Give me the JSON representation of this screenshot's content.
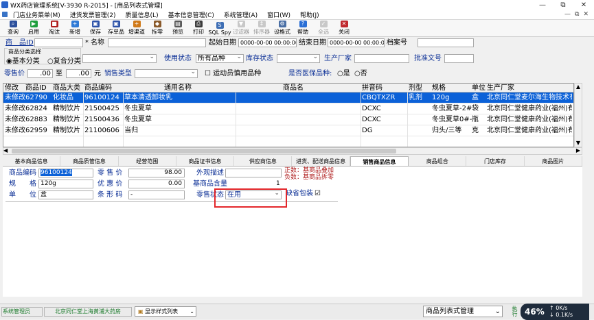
{
  "window": {
    "title": "WX药店管理系统[V-3930 R-2015] - [商品列表式管理]",
    "controls": [
      "—",
      "⧉",
      "✕"
    ]
  },
  "menu": [
    "门店业务菜单(M)",
    "进货发票管理(2)",
    "质量信息(L)",
    "基本信息管理(C)",
    "系统管理(A)",
    "窗口(W)",
    "帮助(J)"
  ],
  "menu_right": [
    "—",
    "⧉",
    "✕"
  ],
  "toolbar": [
    {
      "label": "查询",
      "icon": "binoculars-icon",
      "color": "#2b4f9c",
      "glyph": "⌕",
      "disabled": false
    },
    {
      "label": "启用",
      "icon": "play-icon",
      "color": "#1e9e3c",
      "glyph": "▶",
      "disabled": false
    },
    {
      "label": "淘汰",
      "icon": "stop-icon",
      "color": "#b01e1e",
      "glyph": "■",
      "disabled": false
    },
    {
      "label": "新增",
      "icon": "new-doc-icon",
      "color": "#2f7ad6",
      "glyph": "+",
      "disabled": false
    },
    {
      "label": "保存",
      "icon": "save-icon",
      "color": "#2d52a8",
      "glyph": "▣",
      "disabled": false
    },
    {
      "label": "存单品",
      "icon": "save-item-icon",
      "color": "#2d52a8",
      "glyph": "▣",
      "disabled": false
    },
    {
      "label": "增渠道",
      "icon": "add-channel-icon",
      "color": "#d07a1a",
      "glyph": "+",
      "disabled": false
    },
    {
      "label": "拆零",
      "icon": "split-icon",
      "color": "#8a5a2b",
      "glyph": "◆",
      "disabled": false
    },
    {
      "label": "预览",
      "icon": "preview-icon",
      "color": "#5a5a5a",
      "glyph": "▤",
      "disabled": false
    },
    {
      "label": "打印",
      "icon": "print-icon",
      "color": "#3b3b3b",
      "glyph": "⎙",
      "disabled": false
    },
    {
      "label": "SQL Spy",
      "icon": "sql-spy-icon",
      "color": "#3f6fb5",
      "glyph": "S",
      "disabled": false
    },
    {
      "label": "过滤器",
      "icon": "filter-icon",
      "color": "#888",
      "glyph": "▼",
      "disabled": true
    },
    {
      "label": "排序器",
      "icon": "sort-icon",
      "color": "#888",
      "glyph": "↕",
      "disabled": true
    },
    {
      "label": "设格式",
      "icon": "format-icon",
      "color": "#4a6fa5",
      "glyph": "⚙",
      "disabled": false
    },
    {
      "label": "帮助",
      "icon": "help-icon",
      "color": "#2a6fd6",
      "glyph": "?",
      "disabled": false
    },
    {
      "label": "全选",
      "icon": "select-all-icon",
      "color": "#888",
      "glyph": "✓",
      "disabled": true
    },
    {
      "label": "关闭",
      "icon": "close-icon",
      "color": "#c0282d",
      "glyph": "✕",
      "disabled": false
    }
  ],
  "filters": {
    "product_id_label": "商　品ID",
    "name_label": "名称",
    "start_date_label": "起始日期",
    "start_date_value": "0000-00-00 00:00:00",
    "end_date_label": "结束日期",
    "end_date_value": "0000-00-00 00:00:00",
    "archive_label": "档案号",
    "category_group_label": "商品分类选择",
    "basic_category": "基本分类",
    "compound_category": "复合分类",
    "usage_status_label": "使用状态",
    "usage_status_value": "所有品种",
    "stock_status_label": "库存状态",
    "manufacturer_label": "生产厂家",
    "retail_price_label": "零售价",
    "price_from": ".00",
    "to_label": "至",
    "price_to": ".00",
    "yuan_label": "元",
    "sales_type_label": "销售类型",
    "athlete_label": "运动员慎用品种",
    "approval_label": "批准文号",
    "medical_label": "是否医保品种:",
    "yes_label": "是",
    "no_label": "否"
  },
  "grid": {
    "headers": [
      "修改",
      "商品ID",
      "商品大类",
      "商品编码",
      "通用名称",
      "商品名",
      "拼音码",
      "剂型",
      "规格",
      "单位",
      "生产厂家"
    ],
    "rows": [
      [
        "未修改",
        "62790",
        "化妆品",
        "96100124",
        "草本清透卸妆乳",
        "",
        "CBQTXZR",
        "乳剂",
        "120g",
        "盒",
        "北京同仁堂麦尔海生物技术有"
      ],
      [
        "未修改",
        "62824",
        "精制饮片",
        "21500425",
        "冬虫夏草",
        "",
        "DCXC",
        "",
        "冬虫夏草-2#",
        "袋",
        "北京同仁堂健康药业(福州)有"
      ],
      [
        "未修改",
        "62883",
        "精制饮片",
        "21500436",
        "冬虫夏草",
        "",
        "DCXC",
        "",
        "冬虫夏草0#-",
        "瓶",
        "北京同仁堂健康药业(福州)有"
      ],
      [
        "未修改",
        "62959",
        "精制饮片",
        "21100606",
        "当归",
        "",
        "DG",
        "",
        "归头/三等",
        "克",
        "北京同仁堂健康药业(福州)有"
      ]
    ]
  },
  "tabs": [
    "基本商品信息",
    "商品质管信息",
    "经营范围",
    "商品证书信息",
    "供应商信息",
    "进货、配送商品信息",
    "销售商品信息",
    "商品组合",
    "门店库存",
    "商品图片"
  ],
  "active_tab": 6,
  "sales_panel": {
    "code_label": "商品编码",
    "code_value": "96100124",
    "retail_label": "零 售 价",
    "retail_value": "98.00",
    "appearance_label": "外观描述",
    "note_positive": "正数：基商品叠加",
    "note_negative": "负数：基商品拆零",
    "spec_label": "规　　格",
    "spec_value": "120g",
    "discount_label": "优 惠 价",
    "discount_value": "0.00",
    "base_qty_label": "基商品含量",
    "base_qty_value": "1",
    "unit_label": "单　　位",
    "unit_value": "盒",
    "barcode_label": "条 形 码",
    "barcode_value": "-",
    "retail_status_label": "零售状态",
    "retail_status_value": "在用",
    "default_pack_label": "缺省包装"
  },
  "status": {
    "user": "系统管理员",
    "store": "北京同仁堂上海黄浦大药房",
    "display_style": "显示样式列表",
    "window_select": "商品列表式管理",
    "extra": "执行",
    "net_percent": "46%",
    "up": "0K/s",
    "down": "0.1K/s"
  },
  "colors": {
    "selection": "#0b61d8",
    "highlight_red": "#e3262a",
    "note_red": "#b02020",
    "label_blue": "#0b2f96"
  }
}
